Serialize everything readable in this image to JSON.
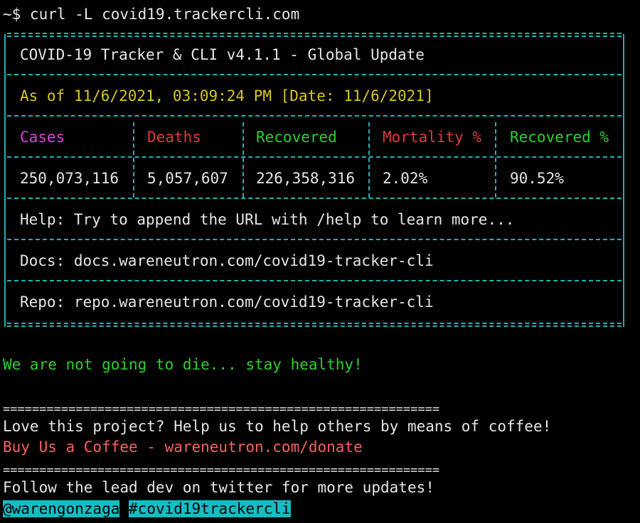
{
  "terminal": {
    "prompt": "~$ curl -L covid19.trackercli.com"
  },
  "tracker": {
    "title": "COVID-19 Tracker & CLI v4.1.1 - Global Update",
    "as_of": "As of 11/6/2021, 03:09:24 PM [Date: 11/6/2021]",
    "columns": [
      "Cases",
      "Deaths",
      "Recovered",
      "Mortality %",
      "Recovered %"
    ],
    "values": [
      "250,073,116",
      "5,057,607",
      "226,358,316",
      "2.02%",
      "90.52%"
    ],
    "help": "Help: Try to append the URL with /help to learn more...",
    "docs": "Docs: docs.wareneutron.com/covid19-tracker-cli",
    "repo": "Repo: repo.wareneutron.com/covid19-tracker-cli"
  },
  "footer": {
    "motto": "We are not going to die... stay healthy!",
    "separator": "============================================================",
    "coffee_text": "Love this project? Help us to help others by means of coffee!",
    "coffee_link": "Buy Us a Coffee - wareneutron.com/donate",
    "follow_text": "Follow the lead dev on twitter for more updates!",
    "twitter_handle": "@warengonzaga",
    "hashtag": "#covid19trackercli"
  },
  "colors": {
    "border": "#1bb3b3",
    "cases": "#e040e0",
    "deaths": "#e03b3b",
    "recovered": "#2ed02e",
    "date": "#d9c71a",
    "link": "#ff5f5f",
    "tag_bg": "#16bcc4"
  }
}
